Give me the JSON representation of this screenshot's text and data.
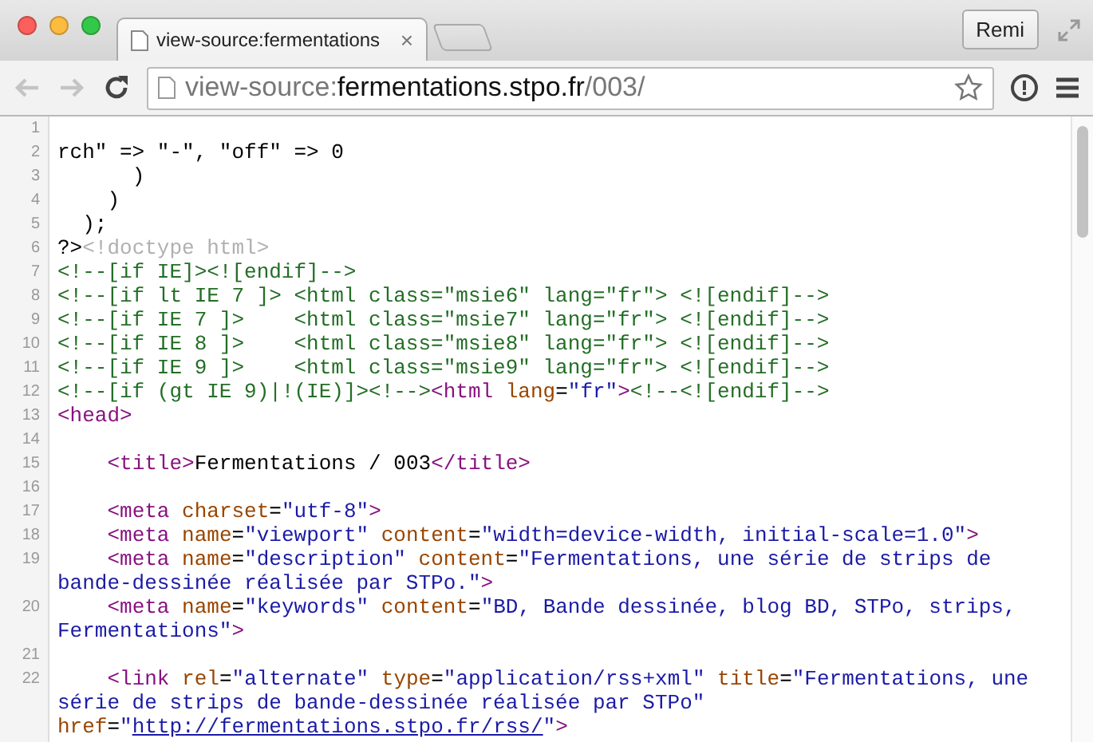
{
  "window": {
    "buttons": [
      {
        "kind": "close"
      },
      {
        "kind": "minimize"
      },
      {
        "kind": "zoom"
      }
    ],
    "profile": "Remi"
  },
  "tabs": [
    {
      "title": "view-source:fermentations",
      "selected": true,
      "close": "×"
    }
  ],
  "toolbar": {
    "back": {
      "disabled": true
    },
    "forward": {
      "disabled": true
    },
    "url": [
      {
        "kind": "dim",
        "text": "view-source:"
      },
      {
        "kind": "host",
        "text": "fermentations.stpo.fr"
      },
      {
        "kind": "dim",
        "text": "/003/"
      }
    ]
  },
  "source": {
    "lines": [
      {
        "number": "1"
      },
      {
        "number": "2",
        "segments": [
          {
            "kind": "text",
            "text": "rch\" => \"-\", \"off\" => 0"
          }
        ]
      },
      {
        "number": "3",
        "segments": [
          {
            "kind": "text",
            "text": "      )"
          }
        ]
      },
      {
        "number": "4",
        "segments": [
          {
            "kind": "text",
            "text": "    )"
          }
        ]
      },
      {
        "number": "5",
        "segments": [
          {
            "kind": "text",
            "text": "  );"
          }
        ]
      },
      {
        "number": "6",
        "segments": [
          {
            "kind": "text",
            "text": "?>"
          },
          {
            "kind": "doctype",
            "text": "<!doctype html>"
          }
        ]
      },
      {
        "number": "7",
        "segments": [
          {
            "kind": "comment",
            "text": "<!--[if IE]><![endif]-->"
          }
        ]
      },
      {
        "number": "8",
        "segments": [
          {
            "kind": "comment",
            "text": "<!--[if lt IE 7 ]> <html class=\"msie6\" lang=\"fr\"> <![endif]-->"
          }
        ]
      },
      {
        "number": "9",
        "segments": [
          {
            "kind": "comment",
            "text": "<!--[if IE 7 ]>    <html class=\"msie7\" lang=\"fr\"> <![endif]-->"
          }
        ]
      },
      {
        "number": "10",
        "segments": [
          {
            "kind": "comment",
            "text": "<!--[if IE 8 ]>    <html class=\"msie8\" lang=\"fr\"> <![endif]-->"
          }
        ]
      },
      {
        "number": "11",
        "segments": [
          {
            "kind": "comment",
            "text": "<!--[if IE 9 ]>    <html class=\"msie9\" lang=\"fr\"> <![endif]-->"
          }
        ]
      },
      {
        "number": "12",
        "segments": [
          {
            "kind": "comment",
            "text": "<!--[if (gt IE 9)|!(IE)]><!-->"
          },
          {
            "kind": "tag",
            "text": "<html"
          },
          {
            "kind": "attr",
            "text": " lang"
          },
          {
            "kind": "text",
            "text": "="
          },
          {
            "kind": "value",
            "text": "\"fr\""
          },
          {
            "kind": "tag",
            "text": ">"
          },
          {
            "kind": "comment",
            "text": "<!--<![endif]-->"
          }
        ]
      },
      {
        "number": "13",
        "segments": [
          {
            "kind": "tag",
            "text": "<head>"
          }
        ]
      },
      {
        "number": "14"
      },
      {
        "number": "15",
        "segments": [
          {
            "kind": "tag",
            "text": "    <title>"
          },
          {
            "kind": "text",
            "text": "Fermentations / 003"
          },
          {
            "kind": "tag",
            "text": "</title>"
          }
        ]
      },
      {
        "number": "16"
      },
      {
        "number": "17",
        "segments": [
          {
            "kind": "tag",
            "text": "    <meta"
          },
          {
            "kind": "attr",
            "text": " charset"
          },
          {
            "kind": "text",
            "text": "="
          },
          {
            "kind": "value",
            "text": "\"utf-8\""
          },
          {
            "kind": "tag",
            "text": ">"
          }
        ]
      },
      {
        "number": "18",
        "segments": [
          {
            "kind": "tag",
            "text": "    <meta"
          },
          {
            "kind": "attr",
            "text": " name"
          },
          {
            "kind": "text",
            "text": "="
          },
          {
            "kind": "value",
            "text": "\"viewport\""
          },
          {
            "kind": "attr",
            "text": " content"
          },
          {
            "kind": "text",
            "text": "="
          },
          {
            "kind": "value",
            "text": "\"width=device-width, initial-scale=1.0\""
          },
          {
            "kind": "tag",
            "text": ">"
          }
        ]
      },
      {
        "number": "19",
        "segments": [
          {
            "kind": "tag",
            "text": "    <meta"
          },
          {
            "kind": "attr",
            "text": " name"
          },
          {
            "kind": "text",
            "text": "="
          },
          {
            "kind": "value",
            "text": "\"description\""
          },
          {
            "kind": "attr",
            "text": " content"
          },
          {
            "kind": "text",
            "text": "="
          },
          {
            "kind": "value",
            "text": "\"Fermentations, une série de strips de bande-dessinée réalisée par STPo.\""
          },
          {
            "kind": "tag",
            "text": ">"
          }
        ]
      },
      {
        "number": "20",
        "segments": [
          {
            "kind": "tag",
            "text": "    <meta"
          },
          {
            "kind": "attr",
            "text": " name"
          },
          {
            "kind": "text",
            "text": "="
          },
          {
            "kind": "value",
            "text": "\"keywords\""
          },
          {
            "kind": "attr",
            "text": " content"
          },
          {
            "kind": "text",
            "text": "="
          },
          {
            "kind": "value",
            "text": "\"BD, Bande dessinée, blog BD, STPo, strips, Fermentations\""
          },
          {
            "kind": "tag",
            "text": ">"
          }
        ]
      },
      {
        "number": "21"
      },
      {
        "number": "22",
        "segments": [
          {
            "kind": "tag",
            "text": "    <link"
          },
          {
            "kind": "attr",
            "text": " rel"
          },
          {
            "kind": "text",
            "text": "="
          },
          {
            "kind": "value",
            "text": "\"alternate\""
          },
          {
            "kind": "attr",
            "text": " type"
          },
          {
            "kind": "text",
            "text": "="
          },
          {
            "kind": "value",
            "text": "\"application/rss+xml\""
          },
          {
            "kind": "attr",
            "text": " title"
          },
          {
            "kind": "text",
            "text": "="
          },
          {
            "kind": "value",
            "text": "\"Fermentations, une série de strips de bande-dessinée réalisée par STPo\""
          },
          {
            "kind": "attr",
            "text": " href"
          },
          {
            "kind": "text",
            "text": "="
          },
          {
            "kind": "value",
            "text": "\""
          },
          {
            "kind": "link",
            "text": "http://fermentations.stpo.fr/rss/"
          },
          {
            "kind": "value",
            "text": "\""
          },
          {
            "kind": "tag",
            "text": ">"
          }
        ]
      }
    ]
  }
}
